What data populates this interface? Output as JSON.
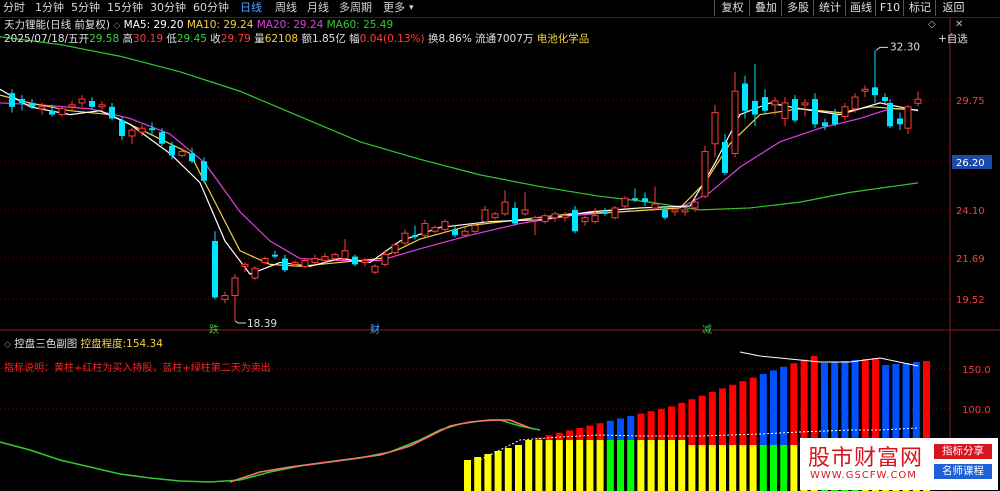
{
  "toolbar": {
    "periods": [
      "分时",
      "1分钟",
      "5分钟",
      "15分钟",
      "30分钟",
      "60分钟",
      "日线",
      "周线",
      "月线",
      "多周期",
      "更多"
    ],
    "active_period": "日线",
    "right_buttons": [
      "复权",
      "叠加",
      "多股",
      "统计",
      "画线",
      "F10",
      "标记",
      "返回"
    ]
  },
  "stock": {
    "name": "天力锂能(日线 前复权)",
    "ma": [
      {
        "label": "MA5: 29.20",
        "color": "#ffffff"
      },
      {
        "label": "MA10: 29.24",
        "color": "#f5d23c"
      },
      {
        "label": "MA20: 29.24",
        "color": "#e040e0"
      },
      {
        "label": "MA60: 25.49",
        "color": "#32c832"
      }
    ],
    "date": "2025/07/18/五",
    "open_label": "开",
    "open": "29.58",
    "high_label": "高",
    "high": "30.19",
    "low_label": "低",
    "low": "29.45",
    "close_label": "收",
    "close": "29.79",
    "vol_label": "量",
    "vol": "62108",
    "amt_label": "额",
    "amt": "1.85亿",
    "chg_label": "幅",
    "chg": "0.04(0.13%)",
    "turn_label": "换",
    "turn": "8.86%",
    "float_label": "流通",
    "float": "7007万",
    "industry": "电池化学品"
  },
  "side_buttons": {
    "plus": "+自选",
    "collapse": "◇",
    "close": "✕"
  },
  "price_axis": {
    "labels": [
      "29.75",
      "26.20",
      "24.10",
      "21.69",
      "19.52"
    ],
    "current": "26.20"
  },
  "annotations": {
    "high": "32.30",
    "low": "18.39",
    "marks": [
      "跌",
      "财",
      "减"
    ]
  },
  "indicator": {
    "name": "控盘三色副图",
    "metric_label": "控盘程度:",
    "metric_value": "154.34",
    "description": "指标说明：黄柱+红柱为买入持股，蓝柱+绿柱第二天为卖出",
    "axis": [
      "150.0",
      "100.0"
    ]
  },
  "watermark": {
    "title": "股市财富网",
    "url": "WWW.GSCFW.COM",
    "tag1": "指标分享",
    "tag2": "名师课程"
  },
  "colors": {
    "up": "#ff3c3c",
    "down": "#00e5ff",
    "ma5": "#ffffff",
    "ma10": "#f5d23c",
    "ma20": "#e040e0",
    "ma60": "#32c832",
    "bar_yellow": "#ffff00",
    "bar_red": "#ff0000",
    "bar_blue": "#0050ff",
    "bar_green": "#00ff00"
  }
}
